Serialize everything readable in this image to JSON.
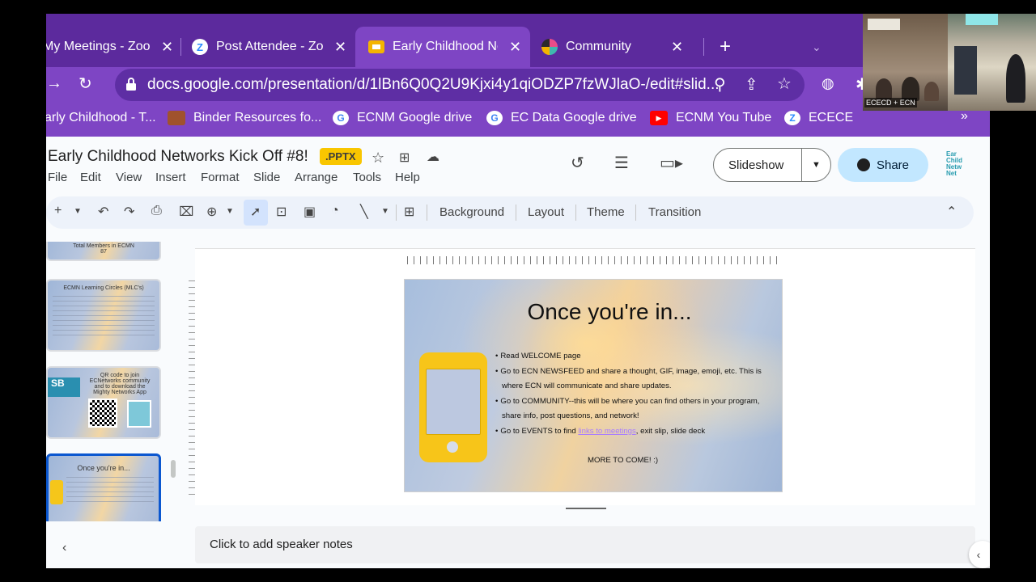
{
  "browser": {
    "tabs": [
      {
        "label": "My Meetings - Zoom",
        "icon": "zoom-icon",
        "active": false
      },
      {
        "label": "Post Attendee - Zoom",
        "icon": "zoom-icon",
        "active": false
      },
      {
        "label": "Early Childhood Networks",
        "icon": "slides-icon",
        "active": true
      },
      {
        "label": "Community",
        "icon": "mighty-networks-icon",
        "active": false
      }
    ],
    "new_tab": "+",
    "url": "docs.google.com/presentation/d/1lBn6Q0Q2U9Kjxi4y1qiODZP7fzWJlaO-/edit#slid...",
    "bookmarks": [
      {
        "label": "arly Childhood - T...",
        "icon": "folder-icon"
      },
      {
        "label": "Binder Resources fo...",
        "icon": "binder-icon"
      },
      {
        "label": "ECNM Google drive",
        "icon": "google-icon"
      },
      {
        "label": "EC Data Google drive",
        "icon": "google-icon"
      },
      {
        "label": "ECNM You Tube",
        "icon": "youtube-icon"
      },
      {
        "label": "ECECE",
        "icon": "zoom-icon"
      }
    ],
    "bookmarks_more": "»",
    "colors": {
      "tabstrip": "#5c2a9d",
      "toolbar": "#7e45c4"
    }
  },
  "slides_app": {
    "doc_title": "Early Childhood Networks Kick Off #8!",
    "badge": ".PPTX",
    "menu": [
      "File",
      "Edit",
      "View",
      "Insert",
      "Format",
      "Slide",
      "Arrange",
      "Tools",
      "Help"
    ],
    "slideshow_label": "Slideshow",
    "share_label": "Share",
    "logo_text": "Ear\nChild\nNetw\nNet",
    "toolbar_text": [
      "Background",
      "Layout",
      "Theme",
      "Transition"
    ],
    "speaker_notes_placeholder": "Click to add speaker notes"
  },
  "filmstrip": [
    {
      "title": "Total Members in ECMN",
      "subtitle": "87"
    },
    {
      "title": "ECMN Learning Circles (MLC's)"
    },
    {
      "title": "QR code to join ECNetworks community and to download the Mighty Networks App",
      "badge": "SB"
    },
    {
      "title": "Once you're in...",
      "selected": true
    }
  ],
  "slide": {
    "title": "Once you're in...",
    "bullets": [
      {
        "text": "Read WELCOME page"
      },
      {
        "text": "Go to ECN NEWSFEED and share a thought, GIF, image, emoji, etc. This is where ECN will communicate and share updates."
      },
      {
        "text": "Go to COMMUNITY--this will be where you can find others in your program, share info, post questions, and network!"
      },
      {
        "prefix": "Go to EVENTS to find ",
        "link": "links to meetings",
        "suffix": ", exit slip, slide deck"
      }
    ],
    "footer": "MORE TO COME! :)"
  },
  "video": {
    "participant_label": "ECECD + ECN"
  }
}
